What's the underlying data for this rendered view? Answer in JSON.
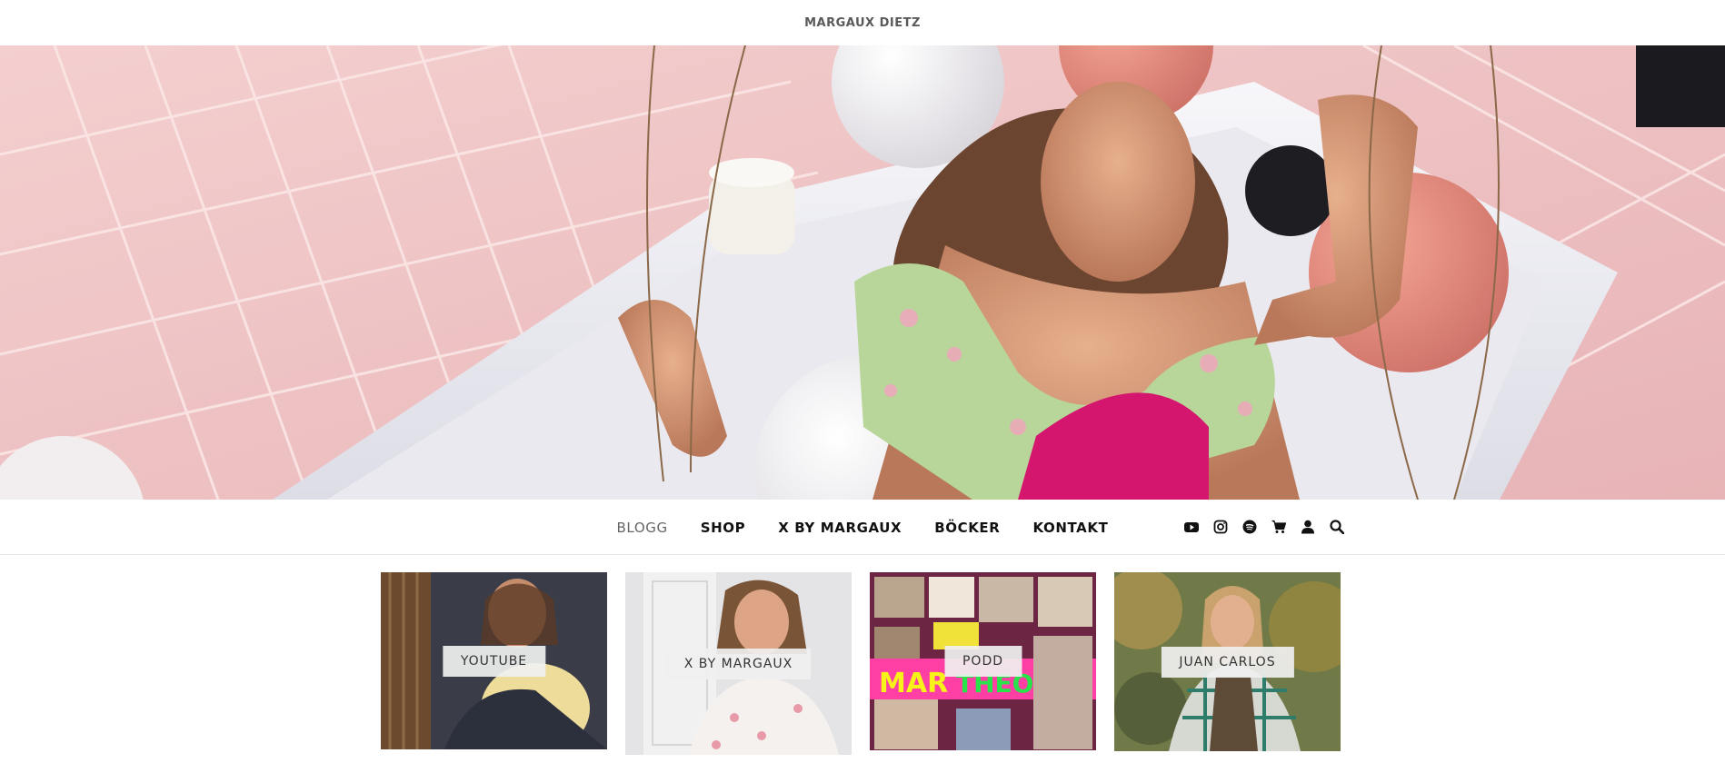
{
  "site": {
    "title": "MARGAUX DIETZ"
  },
  "hero": {
    "alt": ""
  },
  "nav": {
    "items": [
      {
        "label": "BLOGG",
        "active": true
      },
      {
        "label": "SHOP",
        "active": false
      },
      {
        "label": "X BY MARGAUX",
        "active": false
      },
      {
        "label": "BÖCKER",
        "active": false
      },
      {
        "label": "KONTAKT",
        "active": false
      }
    ],
    "icons": [
      "youtube-icon",
      "instagram-icon",
      "spotify-icon",
      "cart-icon",
      "user-icon",
      "search-icon"
    ]
  },
  "tiles": [
    {
      "label": "YOUTUBE"
    },
    {
      "label": "X BY MARGAUX"
    },
    {
      "label": "PODD"
    },
    {
      "label": "JUAN CARLOS"
    }
  ],
  "colors": {
    "accent": "#e8b4b8",
    "text": "#111111",
    "muted": "#666666"
  }
}
